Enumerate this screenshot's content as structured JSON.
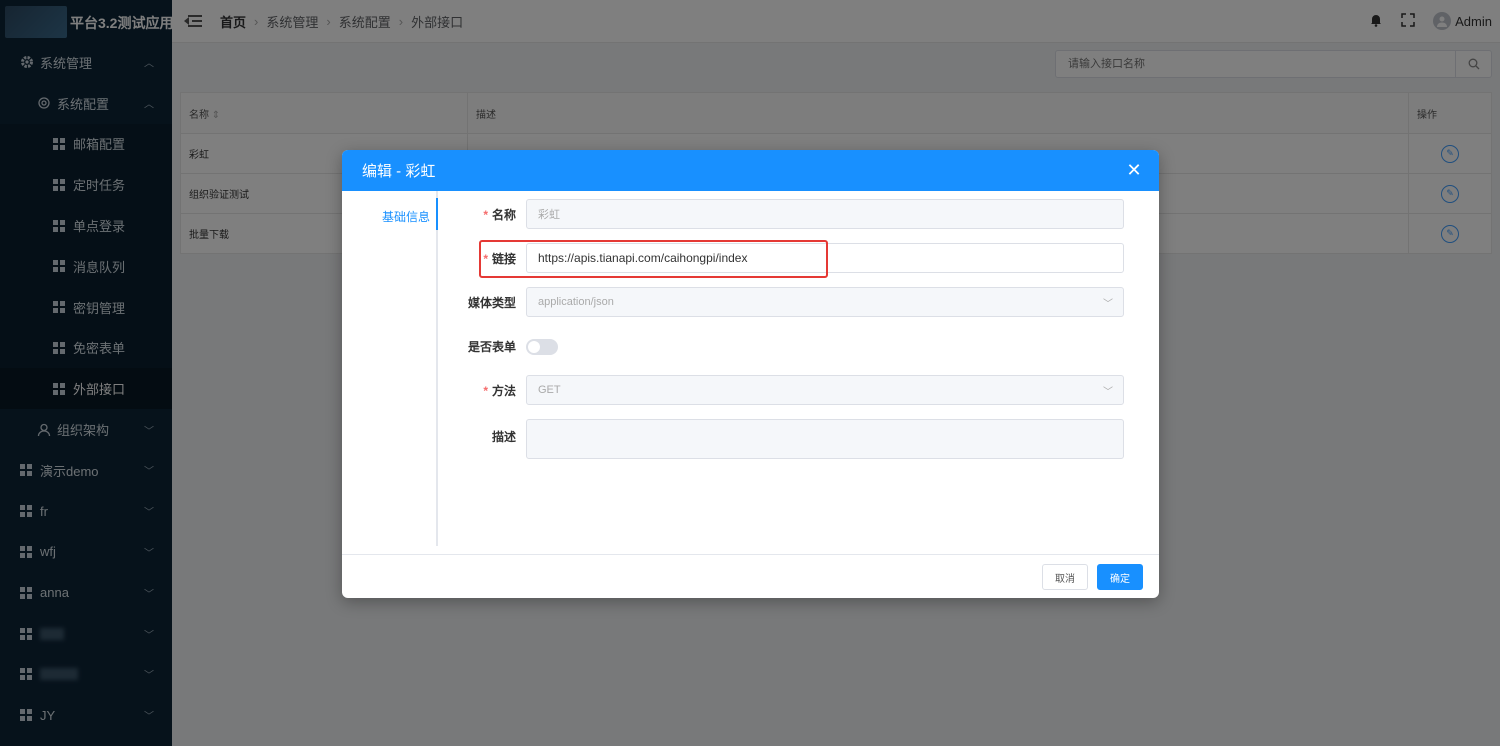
{
  "app": {
    "title": "平台3.2测试应用"
  },
  "header": {
    "breadcrumb": [
      "首页",
      "系统管理",
      "系统配置",
      "外部接口"
    ],
    "user": "Admin"
  },
  "sidebar": {
    "system_management": "系统管理",
    "system_config": "系统配置",
    "config_items": [
      "邮箱配置",
      "定时任务",
      "单点登录",
      "消息队列",
      "密钥管理",
      "免密表单",
      "外部接口"
    ],
    "org": "组织架构",
    "groups": [
      "演示demo",
      "fr",
      "wfj",
      "anna",
      "JY"
    ]
  },
  "search": {
    "placeholder": "请输入接口名称"
  },
  "table": {
    "headers": {
      "name": "名称",
      "desc": "描述",
      "ops": "操作"
    },
    "rows": [
      {
        "name": "彩虹"
      },
      {
        "name": "组织验证测试"
      },
      {
        "name": "批量下载"
      }
    ]
  },
  "dialog": {
    "title": "编辑 - 彩虹",
    "tab": "基础信息",
    "fields": {
      "name_label": "名称",
      "name_value": "彩虹",
      "link_label": "链接",
      "link_value": "https://apis.tianapi.com/caihongpi/index",
      "media_label": "媒体类型",
      "media_value": "application/json",
      "is_form_label": "是否表单",
      "is_form_on": false,
      "method_label": "方法",
      "method_value": "GET",
      "desc_label": "描述"
    },
    "cancel": "取消",
    "ok": "确定"
  },
  "colors": {
    "primary": "#1890ff",
    "sidebar": "#0d2537",
    "highlight": "#e53935"
  }
}
